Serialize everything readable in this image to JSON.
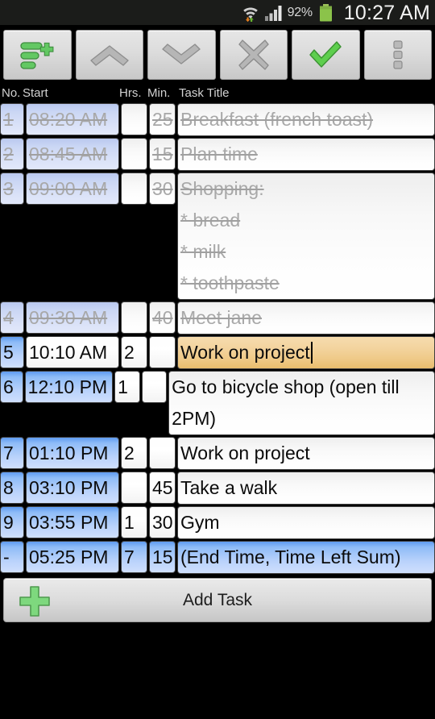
{
  "statusbar": {
    "wifi_icon": "wifi-transfer-icon",
    "signal_icon": "cellular-signal-icon",
    "battery_percent": "92%",
    "battery_icon": "battery-full-icon",
    "clock": "10:27 AM"
  },
  "toolbar": {
    "buttons": [
      {
        "name": "add-task-row-button",
        "icon": "list-add-icon"
      },
      {
        "name": "move-up-button",
        "icon": "chevron-up-icon"
      },
      {
        "name": "move-down-button",
        "icon": "chevron-down-icon"
      },
      {
        "name": "delete-button",
        "icon": "close-x-icon"
      },
      {
        "name": "confirm-button",
        "icon": "checkmark-icon"
      },
      {
        "name": "overflow-menu-button",
        "icon": "three-dots-icon"
      }
    ]
  },
  "table": {
    "headers": {
      "no": "No.",
      "start": "Start",
      "hrs": "Hrs.",
      "min": "Min.",
      "title": "Task Title"
    },
    "rows": [
      {
        "no": "1",
        "start": "08:20 AM",
        "hrs": "",
        "min": "25",
        "title": "Breakfast (french toast)",
        "state": "done"
      },
      {
        "no": "2",
        "start": "08:45 AM",
        "hrs": "",
        "min": "15",
        "title": "Plan time",
        "state": "done"
      },
      {
        "no": "3",
        "start": "09:00 AM",
        "hrs": "",
        "min": "30",
        "title": "Shopping:\n* bread\n* milk\n* toothpaste",
        "state": "done"
      },
      {
        "no": "4",
        "start": "09:30 AM",
        "hrs": "",
        "min": "40",
        "title": "Meet jane",
        "state": "done"
      },
      {
        "no": "5",
        "start": "10:10 AM",
        "hrs": "2",
        "min": "",
        "title": "Work on project",
        "state": "editing"
      },
      {
        "no": "6",
        "start": "12:10 PM",
        "hrs": "1",
        "min": "",
        "title": "Go to bicycle shop (open till 2PM)",
        "state": "pending"
      },
      {
        "no": "7",
        "start": "01:10 PM",
        "hrs": "2",
        "min": "",
        "title": "Work on project",
        "state": "pending"
      },
      {
        "no": "8",
        "start": "03:10 PM",
        "hrs": "",
        "min": "45",
        "title": "Take a walk",
        "state": "pending"
      },
      {
        "no": "9",
        "start": "03:55 PM",
        "hrs": "1",
        "min": "30",
        "title": "Gym",
        "state": "pending"
      },
      {
        "no": "-",
        "start": "05:25 PM",
        "hrs": "7",
        "min": "15",
        "title": "(End Time, Time Left Sum)",
        "state": "summary"
      }
    ]
  },
  "footer": {
    "add_task_label": "Add Task",
    "add_task_icon": "plus-icon"
  },
  "colors": {
    "accent_green": "#7ed87e",
    "row_blue": "#8fbcf7",
    "row_blue_done": "#cad6f4",
    "editing_amber": "#f0cf94",
    "background": "#000000"
  }
}
